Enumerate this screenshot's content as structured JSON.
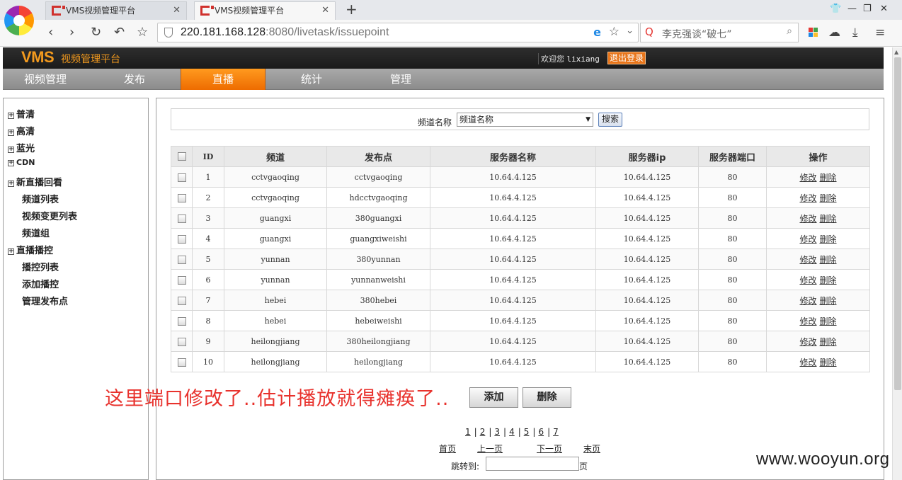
{
  "browser": {
    "tabs": [
      {
        "title": "VMS视频管理平台",
        "active": false
      },
      {
        "title": "VMS视频管理平台",
        "active": true
      }
    ],
    "address": {
      "host": "220.181.168.128",
      "path": ":8080/livetask/issuepoint"
    },
    "search_placeholder": "李克强谈“破七”"
  },
  "header": {
    "logo": "VMS",
    "logo_sub": "视频管理平台",
    "welcome": "欢迎您",
    "user": "lixiang",
    "logout": "退出登录"
  },
  "nav": [
    {
      "label": "视频管理",
      "active": false
    },
    {
      "label": "发布",
      "active": false
    },
    {
      "label": "直播",
      "active": true
    },
    {
      "label": "统计",
      "active": false
    },
    {
      "label": "管理",
      "active": false
    }
  ],
  "sidebar": {
    "groups": [
      "普清",
      "高清",
      "蓝光",
      "CDN",
      "新直播回看"
    ],
    "live_sub": [
      "频道列表",
      "视频变更列表",
      "频道组"
    ],
    "control_group": "直播播控",
    "control_sub": [
      "播控列表",
      "添加播控",
      "管理发布点"
    ]
  },
  "filter": {
    "label": "频道名称",
    "selected": "频道名称",
    "search_button": "搜索"
  },
  "table": {
    "headers": [
      "ID",
      "频道",
      "发布点",
      "服务器名称",
      "服务器ip",
      "服务器端口",
      "操作"
    ],
    "edit_label": "修改",
    "delete_label": "删除",
    "rows": [
      {
        "id": "1",
        "channel": "cctvgaoqing",
        "point": "cctvgaoqing",
        "server_name": "10.64.4.125",
        "server_ip": "10.64.4.125",
        "port": "80"
      },
      {
        "id": "2",
        "channel": "cctvgaoqing",
        "point": "hdcctvgaoqing",
        "server_name": "10.64.4.125",
        "server_ip": "10.64.4.125",
        "port": "80"
      },
      {
        "id": "3",
        "channel": "guangxi",
        "point": "380guangxi",
        "server_name": "10.64.4.125",
        "server_ip": "10.64.4.125",
        "port": "80"
      },
      {
        "id": "4",
        "channel": "guangxi",
        "point": "guangxiweishi",
        "server_name": "10.64.4.125",
        "server_ip": "10.64.4.125",
        "port": "80"
      },
      {
        "id": "5",
        "channel": "yunnan",
        "point": "380yunnan",
        "server_name": "10.64.4.125",
        "server_ip": "10.64.4.125",
        "port": "80"
      },
      {
        "id": "6",
        "channel": "yunnan",
        "point": "yunnanweishi",
        "server_name": "10.64.4.125",
        "server_ip": "10.64.4.125",
        "port": "80"
      },
      {
        "id": "7",
        "channel": "hebei",
        "point": "380hebei",
        "server_name": "10.64.4.125",
        "server_ip": "10.64.4.125",
        "port": "80"
      },
      {
        "id": "8",
        "channel": "hebei",
        "point": "hebeiweishi",
        "server_name": "10.64.4.125",
        "server_ip": "10.64.4.125",
        "port": "80"
      },
      {
        "id": "9",
        "channel": "heilongjiang",
        "point": "380heilongjiang",
        "server_name": "10.64.4.125",
        "server_ip": "10.64.4.125",
        "port": "80"
      },
      {
        "id": "10",
        "channel": "heilongjiang",
        "point": "heilongjiang",
        "server_name": "10.64.4.125",
        "server_ip": "10.64.4.125",
        "port": "80"
      }
    ]
  },
  "annotation": "这里端口修改了..估计播放就得瘫痪了..",
  "actions": {
    "add": "添加",
    "delete": "删除"
  },
  "pager": {
    "pages": [
      "1",
      "2",
      "3",
      "4",
      "5",
      "6",
      "7"
    ],
    "first": "首页",
    "prev": "上一页",
    "next": "下一页",
    "last": "末页",
    "jump_label": "跳转到:",
    "jump_unit": "页"
  },
  "watermark": "www.wooyun.org",
  "colors": {
    "accent": "#f39a1e",
    "active_tab": "#ee6c00",
    "annotation": "#e8322d"
  }
}
